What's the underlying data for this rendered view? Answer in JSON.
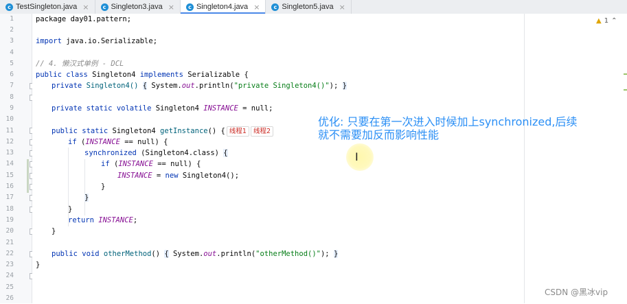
{
  "tabs": [
    {
      "label": "TestSingleton.java",
      "icon": "c-class-icon",
      "active": false
    },
    {
      "label": "Singleton3.java",
      "icon": "c-class-icon",
      "active": false
    },
    {
      "label": "Singleton4.java",
      "icon": "c-class-icon",
      "active": true
    },
    {
      "label": "Singleton5.java",
      "icon": "c-class-icon",
      "active": false
    }
  ],
  "tab_close": "×",
  "line_numbers": [
    "1",
    "2",
    "3",
    "4",
    "5",
    "6",
    "7",
    "8",
    "9",
    "10",
    "11",
    "12",
    "13",
    "14",
    "15",
    "16",
    "17",
    "18",
    "19",
    "20",
    "21",
    "22",
    "23",
    "24",
    "25",
    "26"
  ],
  "code": {
    "l1": "package day01.pattern;",
    "l3_kw": "import",
    "l3_rest": " java.io.Serializable;",
    "l5": "// 4. 懒汉式单例 - DCL",
    "l6_kw1": "public class",
    "l6_name": " Singleton4 ",
    "l6_kw2": "implements",
    "l6_rest": " Serializable {",
    "l7_kw": "private",
    "l7_name": " Singleton4() ",
    "l7_b1": "{",
    "l7_a": " System.",
    "l7_out": "out",
    "l7_b": ".println(",
    "l7_str": "\"private Singleton4()\"",
    "l7_c": "); ",
    "l7_b2": "}",
    "l11_kw": "private static volatile",
    "l11_type": " Singleton4 ",
    "l11_fld": "INSTANCE",
    "l11_rest": " = null;",
    "l13_kw": "public static",
    "l13_type": " Singleton4 ",
    "l13_mth": "getInstance",
    "l13_rest": "() {",
    "l14_kw": "if",
    "l14_a": " (",
    "l14_fld": "INSTANCE",
    "l14_rest": " == null) {",
    "l15_kw": "synchronized",
    "l15_rest": " (Singleton4.class) ",
    "l15_b": "{",
    "l16_kw": "if",
    "l16_a": " (",
    "l16_fld": "INSTANCE",
    "l16_rest": " == null) {",
    "l17_fld": "INSTANCE",
    "l17_a": " = ",
    "l17_kw": "new",
    "l17_rest": " Singleton4();",
    "l18": "}",
    "l19": "}",
    "l20": "}",
    "l21_kw": "return",
    "l21_fld": " INSTANCE",
    "l21_rest": ";",
    "l22": "}",
    "l24_kw": "public void",
    "l24_mth": " otherMethod",
    "l24_a": "() ",
    "l24_b1": "{",
    "l24_c": " System.",
    "l24_out": "out",
    "l24_d": ".println(",
    "l24_str": "\"otherMethod()\"",
    "l24_e": "); ",
    "l24_b2": "}",
    "l25": "}"
  },
  "hints": [
    "线程1",
    "线程2"
  ],
  "annotation": {
    "line1": "优化: 只要在第一次进入时候加上synchronized,后续",
    "line2": "就不需要加反而影响性能"
  },
  "warnings": {
    "count": "1"
  },
  "watermark": "CSDN @黑冰vip",
  "colors": {
    "accent": "#4a88e8",
    "annotation": "#2b8ff5",
    "keyword": "#0033b3",
    "string": "#067d17",
    "field": "#871094",
    "method": "#00627a"
  }
}
